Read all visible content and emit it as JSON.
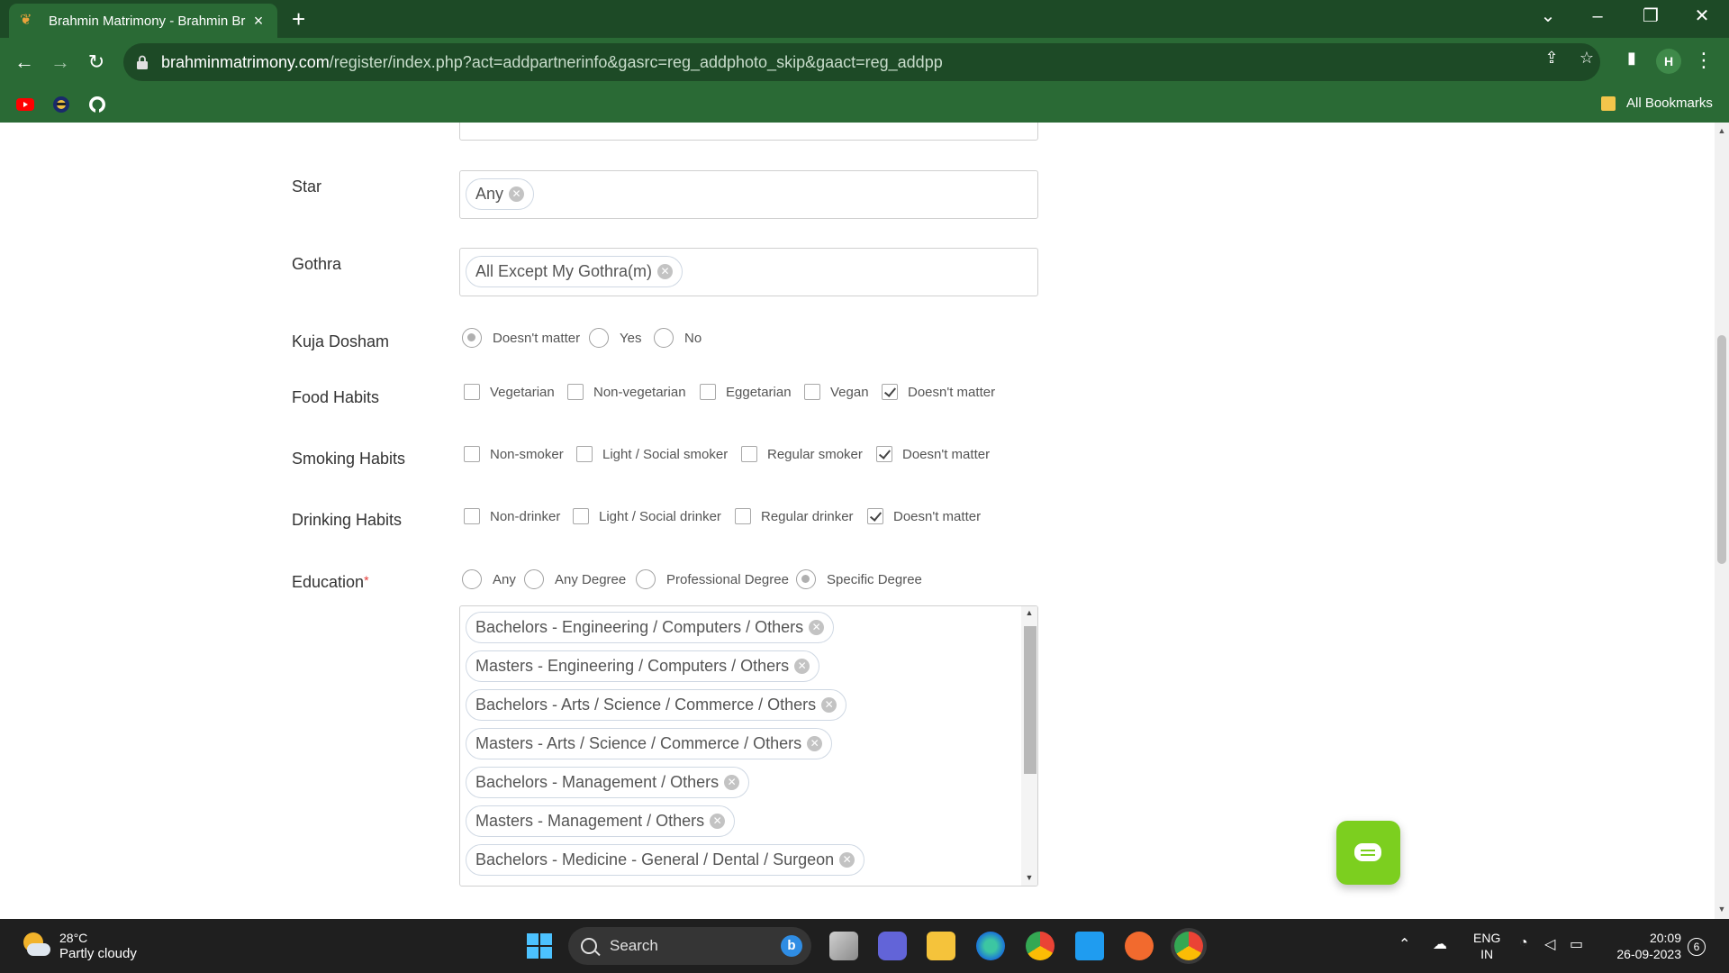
{
  "browser": {
    "tab_title": "Brahmin Matrimony - Brahmin Br",
    "url_domain": "brahminmatrimony.com",
    "url_path": "/register/index.php?act=addpartnerinfo&gasrc=reg_addphoto_skip&gaact=reg_addpp",
    "profile_initial": "H",
    "bookmarks_label": "All Bookmarks"
  },
  "form": {
    "star": {
      "label": "Star",
      "chips": [
        "Any"
      ]
    },
    "gothra": {
      "label": "Gothra",
      "chips": [
        "All Except My Gothra(m)"
      ]
    },
    "kuja_dosham": {
      "label": "Kuja Dosham",
      "options": [
        "Doesn't matter",
        "Yes",
        "No"
      ],
      "selected": "Doesn't matter"
    },
    "food_habits": {
      "label": "Food Habits",
      "options": [
        "Vegetarian",
        "Non-vegetarian",
        "Eggetarian",
        "Vegan",
        "Doesn't matter"
      ],
      "checked": [
        "Doesn't matter"
      ]
    },
    "smoking_habits": {
      "label": "Smoking Habits",
      "options": [
        "Non-smoker",
        "Light / Social smoker",
        "Regular smoker",
        "Doesn't matter"
      ],
      "checked": [
        "Doesn't matter"
      ]
    },
    "drinking_habits": {
      "label": "Drinking Habits",
      "options": [
        "Non-drinker",
        "Light / Social drinker",
        "Regular drinker",
        "Doesn't matter"
      ],
      "checked": [
        "Doesn't matter"
      ]
    },
    "education": {
      "label": "Education",
      "required_mark": "*",
      "options": [
        "Any",
        "Any Degree",
        "Professional Degree",
        "Specific Degree"
      ],
      "selected": "Specific Degree",
      "chips": [
        "Bachelors - Engineering / Computers / Others",
        "Masters - Engineering / Computers / Others",
        "Bachelors - Arts / Science / Commerce / Others",
        "Masters - Arts / Science / Commerce / Others",
        "Bachelors - Management / Others",
        "Masters - Management / Others",
        "Bachelors - Medicine - General / Dental / Surgeon"
      ]
    }
  },
  "taskbar": {
    "temperature": "28°C",
    "weather": "Partly cloudy",
    "search_placeholder": "Search",
    "lang_top": "ENG",
    "lang_bottom": "IN",
    "time": "20:09",
    "date": "26-09-2023",
    "notifications": "6"
  },
  "colors": {
    "chrome_dark": "#1d4a26",
    "chrome": "#2a6a35",
    "chat_button": "#7ccf1f",
    "required": "#e53935"
  }
}
